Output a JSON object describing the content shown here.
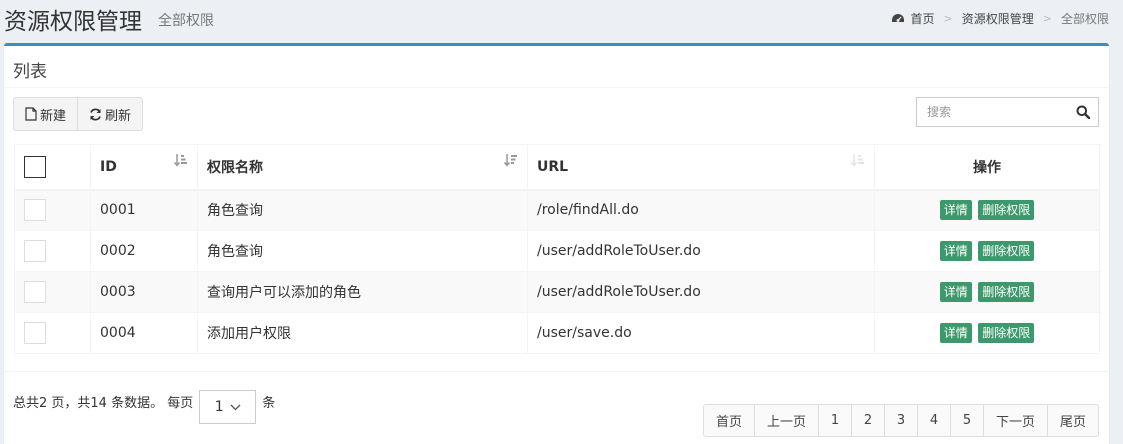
{
  "header": {
    "title": "资源权限管理",
    "subtitle": "全部权限"
  },
  "breadcrumb": {
    "home": "首页",
    "section": "资源权限管理",
    "current": "全部权限"
  },
  "box": {
    "title": "列表"
  },
  "toolbar": {
    "new_label": "新建",
    "refresh_label": "刷新"
  },
  "search": {
    "placeholder": "搜索"
  },
  "table": {
    "columns": {
      "id": "ID",
      "name": "权限名称",
      "url": "URL",
      "operation": "操作"
    },
    "rows": [
      {
        "id": "0001",
        "name": "角色查询",
        "url": "/role/findAll.do"
      },
      {
        "id": "0002",
        "name": "角色查询",
        "url": "/user/addRoleToUser.do"
      },
      {
        "id": "0003",
        "name": "查询用户可以添加的角色",
        "url": "/user/addRoleToUser.do"
      },
      {
        "id": "0004",
        "name": "添加用户权限",
        "url": "/user/save.do"
      }
    ],
    "detail_label": "详情",
    "delete_label": "删除权限"
  },
  "footer": {
    "info": "总共2 页，共14 条数据。 每页",
    "page_size": "1",
    "unit": "条"
  },
  "pagination": {
    "first": "首页",
    "prev": "上一页",
    "pages": [
      "1",
      "2",
      "3",
      "4",
      "5"
    ],
    "next": "下一页",
    "last": "尾页"
  },
  "colors": {
    "accent": "#3c8dbc",
    "button_green": "#3c996b",
    "background": "#ecf0f5"
  }
}
